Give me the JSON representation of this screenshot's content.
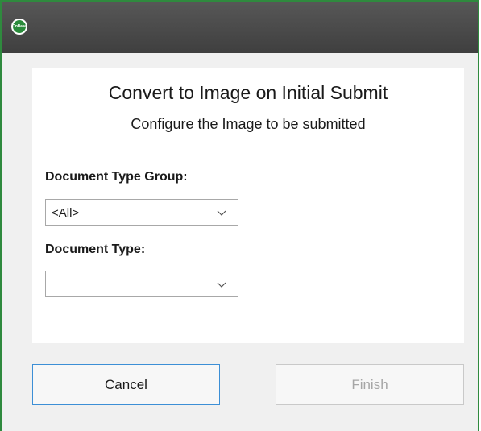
{
  "window": {
    "app_logo_text": "OnBase"
  },
  "dialog": {
    "title": "Convert to Image on Initial Submit",
    "subtitle": "Configure the Image to be submitted"
  },
  "fields": {
    "document_type_group": {
      "label": "Document Type Group:",
      "value": "<All>",
      "icon": "chevron-down-icon"
    },
    "document_type": {
      "label": "Document Type:",
      "value": "",
      "icon": "chevron-down-icon"
    }
  },
  "buttons": {
    "cancel_label": "Cancel",
    "finish_label": "Finish",
    "finish_enabled": false
  },
  "colors": {
    "window_border": "#2f8a3e",
    "titlebar": "#4b4b4b",
    "cancel_focus_border": "#3c8fd6",
    "disabled_text": "#a6a6a6"
  }
}
